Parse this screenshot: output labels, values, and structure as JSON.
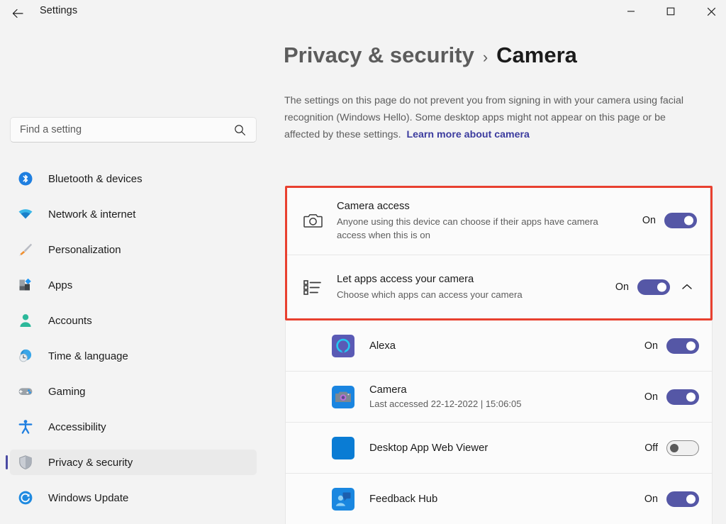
{
  "window": {
    "app_title": "Settings",
    "back_icon": "back-arrow-icon",
    "minimize_label": "—",
    "maximize_label": "□",
    "close_label": "✕"
  },
  "search": {
    "placeholder": "Find a setting",
    "value": "",
    "icon": "search-icon"
  },
  "sidebar": {
    "items": [
      {
        "label": "Bluetooth & devices",
        "icon": "bluetooth-icon",
        "selected": false
      },
      {
        "label": "Network & internet",
        "icon": "wifi-icon",
        "selected": false
      },
      {
        "label": "Personalization",
        "icon": "paintbrush-icon",
        "selected": false
      },
      {
        "label": "Apps",
        "icon": "apps-icon",
        "selected": false
      },
      {
        "label": "Accounts",
        "icon": "account-icon",
        "selected": false
      },
      {
        "label": "Time & language",
        "icon": "clock-globe-icon",
        "selected": false
      },
      {
        "label": "Gaming",
        "icon": "gamepad-icon",
        "selected": false
      },
      {
        "label": "Accessibility",
        "icon": "accessibility-icon",
        "selected": false
      },
      {
        "label": "Privacy & security",
        "icon": "shield-icon",
        "selected": true
      },
      {
        "label": "Windows Update",
        "icon": "update-refresh-icon",
        "selected": false
      }
    ]
  },
  "header": {
    "breadcrumb_parent": "Privacy & security",
    "breadcrumb_separator": "›",
    "breadcrumb_current": "Camera",
    "description": "The settings on this page do not prevent you from signing in with your camera using facial recognition (Windows Hello). Some desktop apps might not appear on this page or be affected by these settings.  ",
    "description_link": "Learn more about camera"
  },
  "settings_cards": [
    {
      "title": "Camera access",
      "subtitle": "Anyone using this device can choose if their apps have camera access when this is on",
      "state": "On",
      "toggle": "on",
      "icon": "camera-icon",
      "expander": false
    },
    {
      "title": "Let apps access your camera",
      "subtitle": "Choose which apps can access your camera",
      "state": "On",
      "toggle": "on",
      "icon": "list-icon",
      "expander": true,
      "expander_icon": "chevron-up-icon"
    }
  ],
  "highlight": {
    "color": "#e8402f"
  },
  "apps": [
    {
      "name": "Alexa",
      "subtitle": "",
      "state": "On",
      "toggle": "on",
      "icon": "alexa-app-icon"
    },
    {
      "name": "Camera",
      "subtitle": "Last accessed 22-12-2022  |  15:06:05",
      "state": "On",
      "toggle": "on",
      "icon": "camera-app-icon"
    },
    {
      "name": "Desktop App Web Viewer",
      "subtitle": "",
      "state": "Off",
      "toggle": "off",
      "icon": "desktop-app-web-viewer-icon"
    },
    {
      "name": "Feedback Hub",
      "subtitle": "",
      "state": "On",
      "toggle": "on",
      "icon": "feedback-hub-icon"
    }
  ],
  "colors": {
    "accent_toggle_on": "#5557a6",
    "link": "#3b3b9e",
    "selected_nav_accent": "#4b4ba3",
    "page_background": "#f3f3f3",
    "card_background": "#fbfbfb"
  }
}
